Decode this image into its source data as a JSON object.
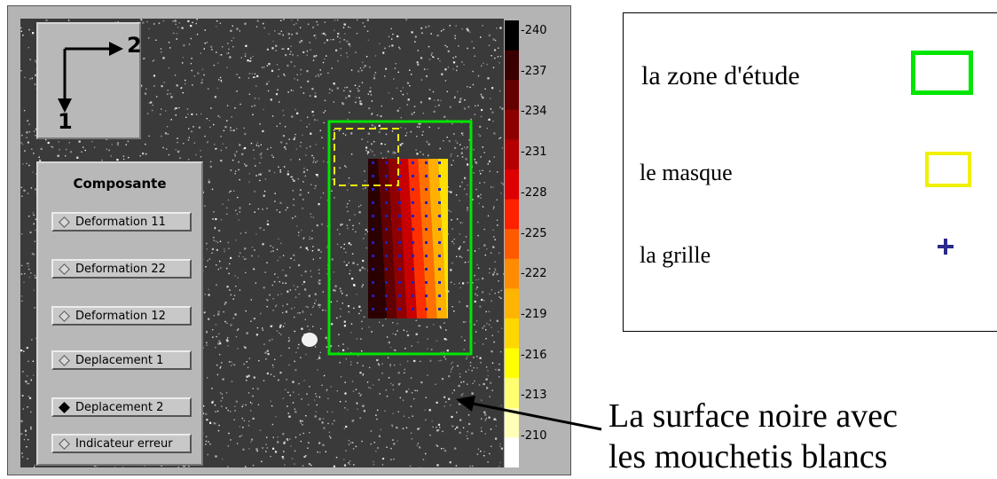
{
  "axes": {
    "horizontal_label": "2",
    "vertical_label": "1"
  },
  "component_panel": {
    "title": "Composante",
    "options": [
      {
        "label": "Deformation 11",
        "selected": false
      },
      {
        "label": "Deformation 22",
        "selected": false
      },
      {
        "label": "Deformation 12",
        "selected": false
      },
      {
        "label": "Deplacement 1",
        "selected": false
      },
      {
        "label": "Deplacement 2",
        "selected": true
      },
      {
        "label": "Indicateur erreur",
        "selected": false
      }
    ]
  },
  "colorbar": {
    "ticks": [
      "-240",
      "-237",
      "-234",
      "-231",
      "-228",
      "-225",
      "-222",
      "-219",
      "-216",
      "-213",
      "-210"
    ],
    "colors": [
      "#000000",
      "#3a0000",
      "#640000",
      "#8c0000",
      "#b40000",
      "#dc0000",
      "#ff2000",
      "#ff5a00",
      "#ff8c00",
      "#ffb400",
      "#ffd700",
      "#ffff00",
      "#ffff70",
      "#ffffb8",
      "#ffffff"
    ]
  },
  "overlay_colors": {
    "study_zone": "#00e600",
    "mask": "#f0f000",
    "grid": "#2020c0"
  },
  "legend": {
    "zone_label": "la zone d'étude",
    "mask_label": "le masque",
    "grid_label": "la grille"
  },
  "annotation": {
    "line1": "La surface noire avec",
    "line2": "les mouchetis blancs"
  }
}
